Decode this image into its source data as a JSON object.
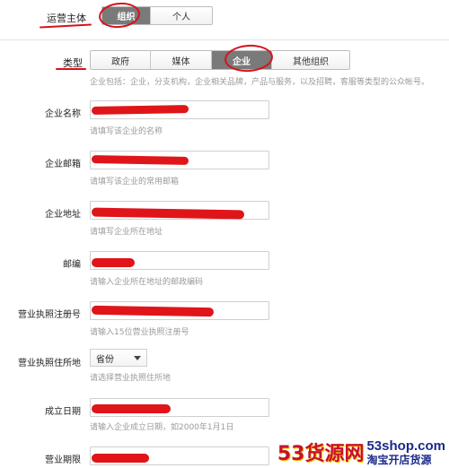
{
  "subject": {
    "label": "运营主体",
    "options": [
      "组织",
      "个人"
    ],
    "selected": "组织"
  },
  "type": {
    "label": "类型",
    "options": [
      "政府",
      "媒体",
      "企业",
      "其他组织"
    ],
    "selected": "企业",
    "description": "企业包括：企业，分支机构，企业相关品牌，产品与服务，以及招聘，客服等类型的公众帐号。"
  },
  "fields": [
    {
      "label": "企业名称",
      "hint": "请填写该企业的名称"
    },
    {
      "label": "企业邮箱",
      "hint": "请填写该企业的常用邮箱"
    },
    {
      "label": "企业地址",
      "hint": "请填写企业所在地址"
    },
    {
      "label": "邮编",
      "hint": "请输入企业所在地址的邮政编码"
    },
    {
      "label": "营业执照注册号",
      "hint": "请输入15位营业执照注册号"
    },
    {
      "label": "营业执照住所地",
      "hint": "请选择营业执照住所地",
      "select": "省份"
    },
    {
      "label": "成立日期",
      "hint": "请输入企业成立日期，如2000年1月1日"
    },
    {
      "label": "营业期限",
      "hint": ""
    }
  ],
  "watermark": {
    "brand": "53货源网",
    "site": "53shop.com",
    "tagline": "淘宝开店货源"
  },
  "colors": {
    "annotation_red": "#d6121a",
    "active_segment": "#7a7a7a",
    "hint_gray": "#9a9a9a"
  }
}
